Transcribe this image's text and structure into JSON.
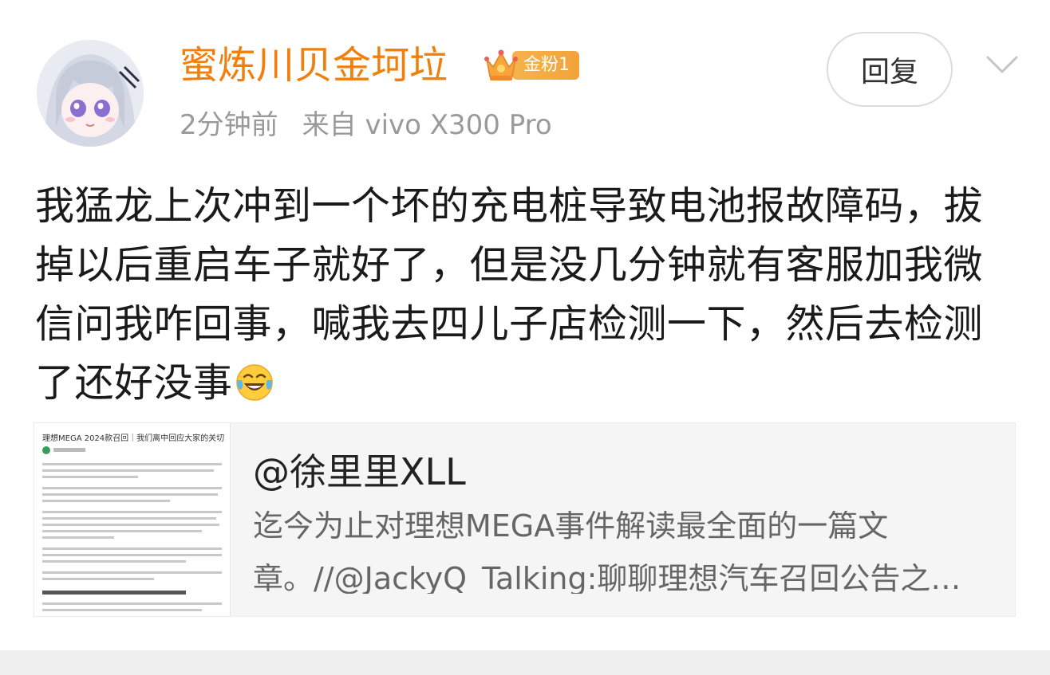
{
  "post": {
    "username": "蜜炼川贝金坷垃",
    "fan_badge": "金粉1",
    "time": "2分钟前",
    "source": "来自 vivo X300 Pro",
    "reply_button": "回复",
    "text": "我猛龙上次冲到一个坏的充电桩导致电池报故障码，拔掉以后重启车子就好了，但是没几分钟就有客服加我微信问我咋回事，喊我去四儿子店检测一下，然后去检测了还好没事"
  },
  "shared_card": {
    "title": "@徐里里XLL",
    "desc_line1": "迄今为止对理想MEGA事件解读最全面的一篇文",
    "desc_line2": "章。//@JackyQ_Talking:聊聊理想汽车召回公告之…",
    "thumb_heading": "理想MEGA 2024款召回｜我们离中回应大家的关切"
  },
  "icons": {
    "crown": "crown-icon",
    "chevron": "chevron-down-icon",
    "emoji": "laughing-crying-emoji-icon"
  },
  "colors": {
    "username": "#f07f0c",
    "badge": "#f4a23a"
  }
}
